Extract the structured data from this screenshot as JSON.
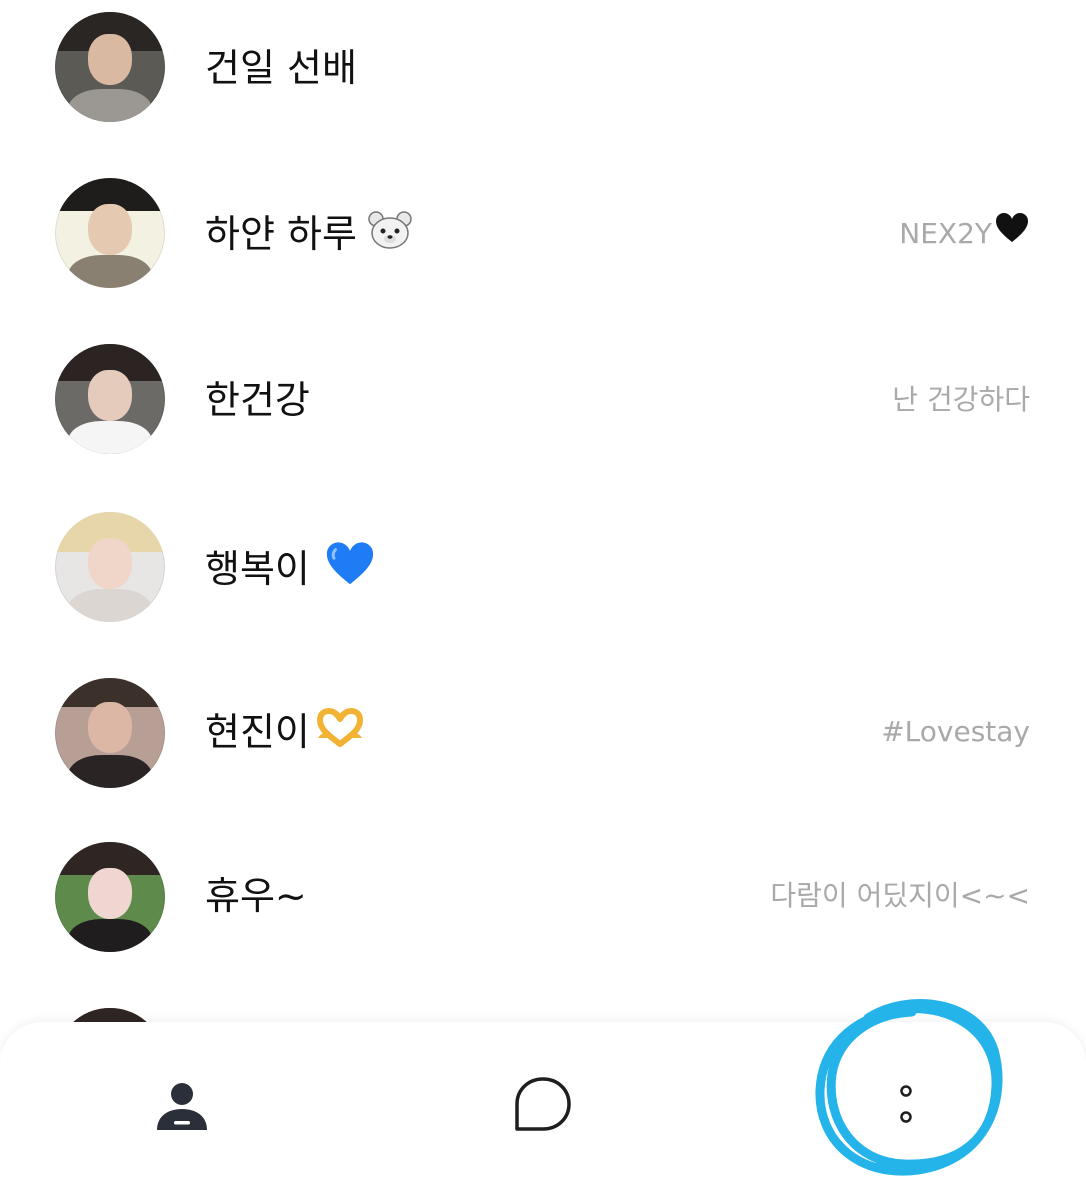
{
  "friends": [
    {
      "name": "건일 선배",
      "status": "",
      "avatar_colors": {
        "bg": "#5b5a55",
        "hair": "#2a2624",
        "skin": "#d9b9a2",
        "body": "#9b9893"
      }
    },
    {
      "name": "하얀 하루",
      "name_emoji": "bear-emoji",
      "status": "NEX2Y",
      "status_emoji": "black-heart-emoji",
      "avatar_colors": {
        "bg": "#f3f1e2",
        "hair": "#1e1d1c",
        "skin": "#e5c9b1",
        "body": "#8a8072"
      }
    },
    {
      "name": "한건강",
      "status": "난 건강하다",
      "avatar_colors": {
        "bg": "#6b6a66",
        "hair": "#2b2423",
        "skin": "#e4cbbb",
        "body": "#f5f5f5"
      }
    },
    {
      "name": "행복이",
      "name_emoji": "blue-heart-emoji",
      "status": "",
      "avatar_colors": {
        "bg": "#e8e6e5",
        "hair": "#e6d6a9",
        "skin": "#efd6c9",
        "body": "#dcd6d3"
      }
    },
    {
      "name": "현진이",
      "name_emoji": "heart-hands-emoji",
      "status": "#Lovestay",
      "avatar_colors": {
        "bg": "#b79f95",
        "hair": "#3c302b",
        "skin": "#dcb7a5",
        "body": "#2b2424"
      }
    },
    {
      "name": "휴우~",
      "status": "다람이 어딨지이<~<",
      "avatar_colors": {
        "bg": "#5e8a4b",
        "hair": "#2f2624",
        "skin": "#f0d6d0",
        "body": "#1f1d1d"
      }
    }
  ],
  "nav": {
    "items": [
      {
        "name": "friends",
        "icon": "person-icon"
      },
      {
        "name": "chats",
        "icon": "chat-bubble-icon"
      },
      {
        "name": "more",
        "icon": "more-icon"
      }
    ],
    "highlight_color": "#25b4ea"
  }
}
